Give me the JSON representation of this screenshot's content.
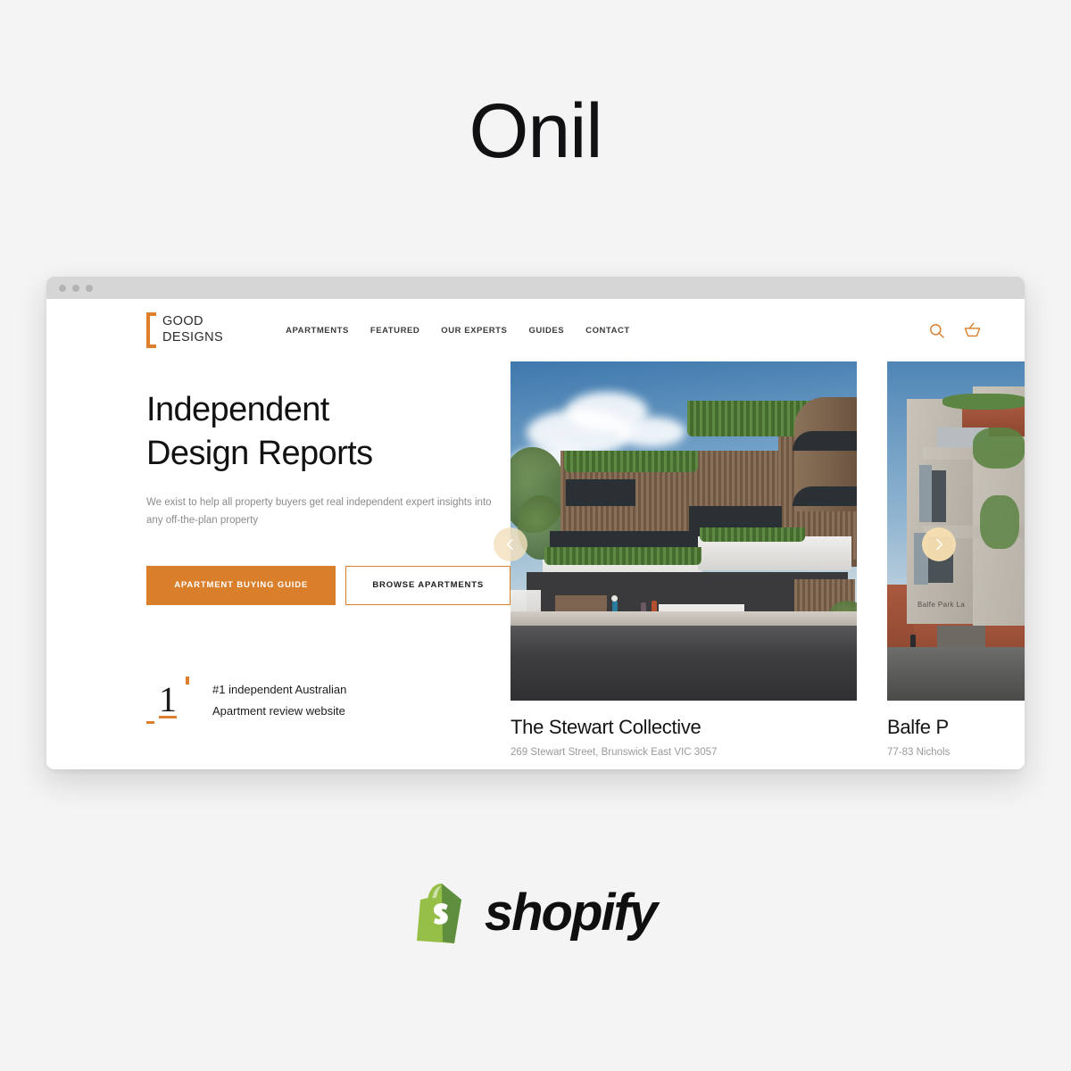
{
  "page": {
    "title": "Onil",
    "background_color": "#f4f4f4"
  },
  "colors": {
    "brand_orange": "#d97e2b",
    "logo_bracket": "#dd7f2d",
    "arrow_cream": "#f6dfb1",
    "shopify_green": "#95bf47",
    "text_dark": "#121214",
    "text_muted": "#8b8b8f"
  },
  "browser": {
    "traffic_lights": [
      "dot-1",
      "dot-2",
      "dot-3"
    ]
  },
  "site": {
    "logo": {
      "line1": "GOOD",
      "line2": "DESIGNS",
      "bracket_icon": "bracket-icon"
    },
    "nav": [
      {
        "label": "APARTMENTS",
        "name": "nav-item-apartments"
      },
      {
        "label": "FEATURED",
        "name": "nav-item-featured"
      },
      {
        "label": "OUR EXPERTS",
        "name": "nav-item-our-experts"
      },
      {
        "label": "GUIDES",
        "name": "nav-item-guides"
      },
      {
        "label": "CONTACT",
        "name": "nav-item-contact"
      }
    ],
    "actions": {
      "search_icon": "search-icon",
      "cart_icon": "shopping-basket-icon"
    }
  },
  "hero": {
    "title_line1": "Independent",
    "title_line2": "Design Reports",
    "subtitle": "We exist to help all property buyers get real independent expert insights into any off-the-plan property",
    "primary_button": "APARTMENT BUYING GUIDE",
    "secondary_button": "BROWSE APARTMENTS",
    "badge": {
      "numeral": "1",
      "line1": "#1 independent Australian",
      "line2": "Apartment review website"
    }
  },
  "carousel": {
    "prev_icon": "chevron-left-icon",
    "next_icon": "chevron-right-icon",
    "cards": [
      {
        "title": "The Stewart Collective",
        "address": "269 Stewart Street, Brunswick East VIC 3057",
        "image_alt": "timber-battened apartment building render"
      },
      {
        "title": "Balfe P",
        "address": "77-83 Nichols",
        "image_alt": "concrete and brick apartment building with Balfe Park Lane signage",
        "signage": "Balfe Park La"
      }
    ]
  },
  "footer": {
    "shopify_wordmark": "shopify",
    "shopify_bag_icon": "shopify-bag-icon"
  }
}
